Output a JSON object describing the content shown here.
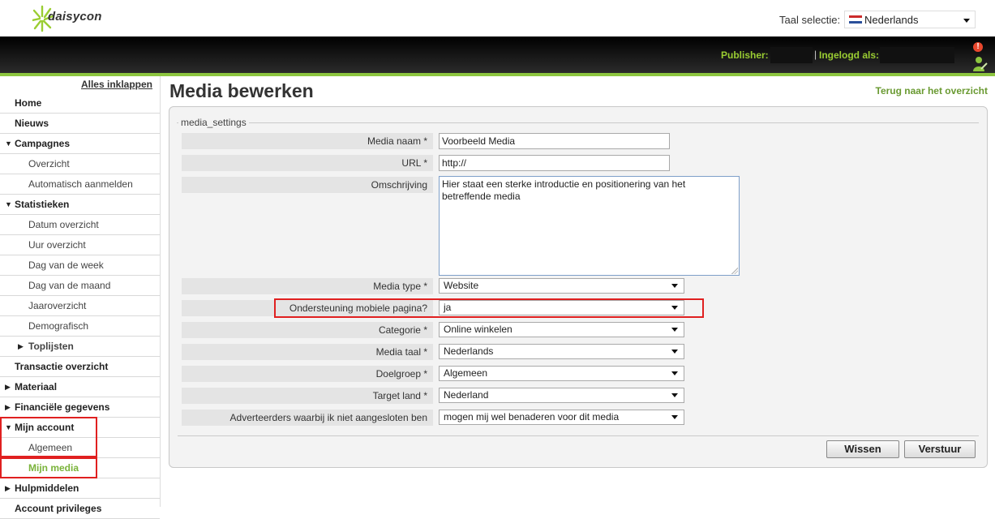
{
  "header": {
    "logo_text": "daisycon",
    "language_label": "Taal selectie:",
    "language_value": "Nederlands",
    "publisher_label": "Publisher:",
    "separator": "|",
    "logged_in_label": "Ingelogd als:",
    "alert_glyph": "!"
  },
  "sidebar": {
    "collapse_label": "Alles inklappen",
    "items": [
      {
        "label": "Home",
        "level": "top",
        "arrow": ""
      },
      {
        "label": "Nieuws",
        "level": "top",
        "arrow": ""
      },
      {
        "label": "Campagnes",
        "level": "top",
        "arrow": "▼"
      },
      {
        "label": "Overzicht",
        "level": "sub",
        "arrow": ""
      },
      {
        "label": "Automatisch aanmelden",
        "level": "sub",
        "arrow": ""
      },
      {
        "label": "Statistieken",
        "level": "top",
        "arrow": "▼"
      },
      {
        "label": "Datum overzicht",
        "level": "sub",
        "arrow": ""
      },
      {
        "label": "Uur overzicht",
        "level": "sub",
        "arrow": ""
      },
      {
        "label": "Dag van de week",
        "level": "sub",
        "arrow": ""
      },
      {
        "label": "Dag van de maand",
        "level": "sub",
        "arrow": ""
      },
      {
        "label": "Jaaroverzicht",
        "level": "sub",
        "arrow": ""
      },
      {
        "label": "Demografisch",
        "level": "sub",
        "arrow": ""
      },
      {
        "label": "Toplijsten",
        "level": "subtop",
        "arrow": "▶"
      },
      {
        "label": "Transactie overzicht",
        "level": "top",
        "arrow": ""
      },
      {
        "label": "Materiaal",
        "level": "top",
        "arrow": "▶"
      },
      {
        "label": "Financiële gegevens",
        "level": "top",
        "arrow": "▶"
      },
      {
        "label": "Mijn account",
        "level": "top",
        "arrow": "▼"
      },
      {
        "label": "Algemeen",
        "level": "sub",
        "arrow": ""
      },
      {
        "label": "Mijn media",
        "level": "active",
        "arrow": ""
      },
      {
        "label": "Hulpmiddelen",
        "level": "top",
        "arrow": "▶"
      },
      {
        "label": "Account privileges",
        "level": "top",
        "arrow": ""
      }
    ]
  },
  "main": {
    "title": "Media bewerken",
    "back_link": "Terug naar het overzicht",
    "legend": "media_settings",
    "fields": {
      "media_name": {
        "label": "Media naam *",
        "value": "Voorbeeld Media"
      },
      "url": {
        "label": "URL *",
        "value": "http://"
      },
      "description": {
        "label": "Omschrijving",
        "value": "Hier staat een sterke introductie en positionering van het betreffende media"
      },
      "media_type": {
        "label": "Media type *",
        "value": "Website"
      },
      "mobile": {
        "label": "Ondersteuning mobiele pagina?",
        "value": "ja"
      },
      "category": {
        "label": "Categorie *",
        "value": "Online winkelen"
      },
      "media_language": {
        "label": "Media taal *",
        "value": "Nederlands"
      },
      "target_group": {
        "label": "Doelgroep *",
        "value": "Algemeen"
      },
      "target_country": {
        "label": "Target land *",
        "value": "Nederland"
      },
      "advertisers": {
        "label": "Adverteerders waarbij ik niet aangesloten ben",
        "value": "mogen mij wel benaderen voor dit media"
      }
    },
    "buttons": {
      "clear": "Wissen",
      "submit": "Verstuur"
    }
  },
  "colors": {
    "accent_green": "#8dc63f",
    "highlight_red": "#e02020"
  }
}
